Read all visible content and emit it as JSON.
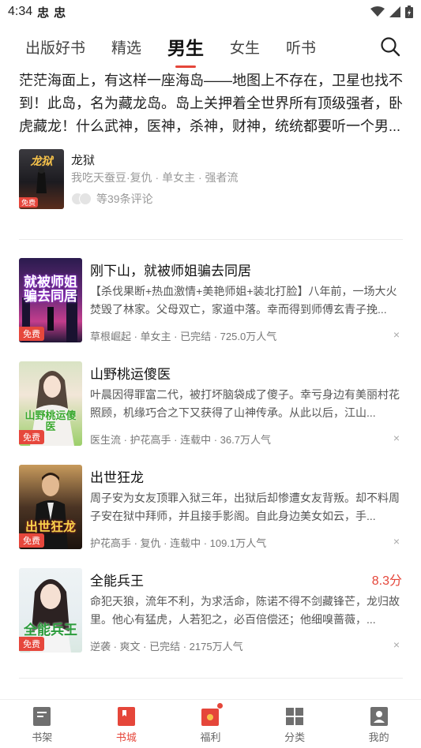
{
  "status_bar": {
    "time": "4:34",
    "glyphs": [
      "忠",
      "忠"
    ]
  },
  "tabs": [
    {
      "label": "出版好书",
      "active": false
    },
    {
      "label": "精选",
      "active": false
    },
    {
      "label": "男生",
      "active": true
    },
    {
      "label": "女生",
      "active": false
    },
    {
      "label": "听书",
      "active": false
    }
  ],
  "featured": {
    "text": "茫茫海面上，有这样一座海岛——地图上不存在，卫星也找不到！此岛，名为藏龙岛。岛上关押着全世界所有顶级强者，卧虎藏龙！什么武神，医神，杀神，财神，统统都要听一个男...",
    "cover_text": "龙狱",
    "free_label": "免费",
    "title": "龙狱",
    "meta": "我吃天蚕豆·复仇 · 单女主 · 强者流",
    "comments": "等39条评论"
  },
  "books": [
    {
      "title": "刚下山，就被师姐骗去同居",
      "cover_text": "就被师姐骗去同居",
      "free_label": "免费",
      "desc": "【杀伐果断+热血激情+美艳师姐+装北打脸】八年前，一场大火焚毁了林家。父母双亡，家道中落。幸而得到师傅玄青子挽...",
      "meta": "草根崛起 · 单女主 · 已完结 · 725.0万人气",
      "score": "",
      "close": "×"
    },
    {
      "title": "山野桃运傻医",
      "cover_text": "山野桃运傻医",
      "free_label": "免费",
      "desc": "叶晨因得罪富二代，被打坏脑袋成了傻子。幸亏身边有美丽村花照顾，机缘巧合之下又获得了山神传承。从此以后，江山...",
      "meta": "医生流 · 护花高手 · 连载中 · 36.7万人气",
      "score": "",
      "close": "×"
    },
    {
      "title": "出世狂龙",
      "cover_text": "出世狂龙",
      "free_label": "免费",
      "desc": "周子安为女友顶罪入狱三年，出狱后却惨遭女友背叛。却不料周子安在狱中拜师，并且接手影阁。自此身边美女如云，手...",
      "meta": "护花高手 · 复仇 · 连载中 · 109.1万人气",
      "score": "",
      "close": "×"
    },
    {
      "title": "全能兵王",
      "cover_text": "全能兵王",
      "free_label": "免费",
      "desc": "命犯天狼，流年不利，为求活命，陈诺不得不剑藏锋芒，龙归故里。他心有猛虎，人若犯之，必百倍偿还；他细嗅蔷薇，...",
      "meta": "逆袭 · 爽文 · 已完结 · 2175万人气",
      "score": "8.3分",
      "close": "×"
    }
  ],
  "bottom_nav": [
    {
      "label": "书架",
      "active": false,
      "icon": "bookshelf-icon"
    },
    {
      "label": "书城",
      "active": true,
      "icon": "bookstore-icon"
    },
    {
      "label": "福利",
      "active": false,
      "icon": "gift-icon"
    },
    {
      "label": "分类",
      "active": false,
      "icon": "category-icon"
    },
    {
      "label": "我的",
      "active": false,
      "icon": "profile-icon"
    }
  ],
  "colors": {
    "accent": "#e5463a"
  }
}
